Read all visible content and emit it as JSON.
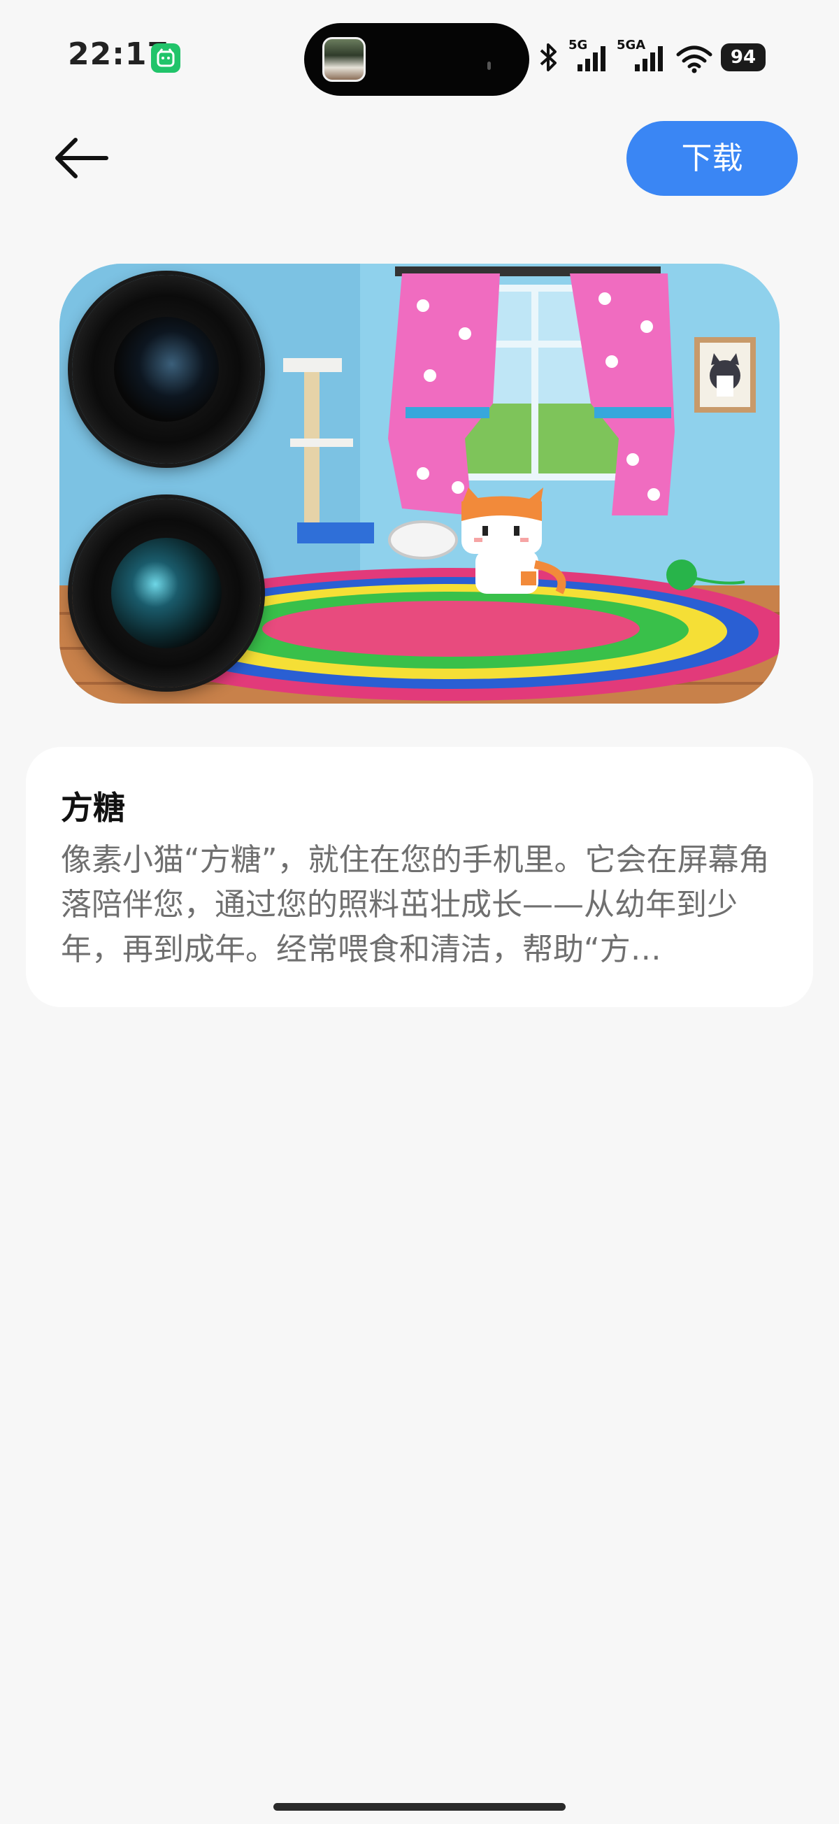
{
  "status_bar": {
    "time": "22:17",
    "network_1": "5G",
    "network_2": "5GA",
    "battery": "94"
  },
  "header": {
    "back_icon": "arrow-left-icon",
    "download_label": "下载"
  },
  "preview": {
    "scene": "pixel-cat-room"
  },
  "card": {
    "title": "方糖",
    "description": "像素小猫“方糖”，就住在您的手机里。它会在屏幕角落陪伴您，通过您的照料茁壮成长——从幼年到少年，再到成年。经常喂食和清洁，帮助“方…"
  },
  "colors": {
    "accent": "#3a86f4",
    "background": "#f7f7f7",
    "card": "#ffffff"
  }
}
